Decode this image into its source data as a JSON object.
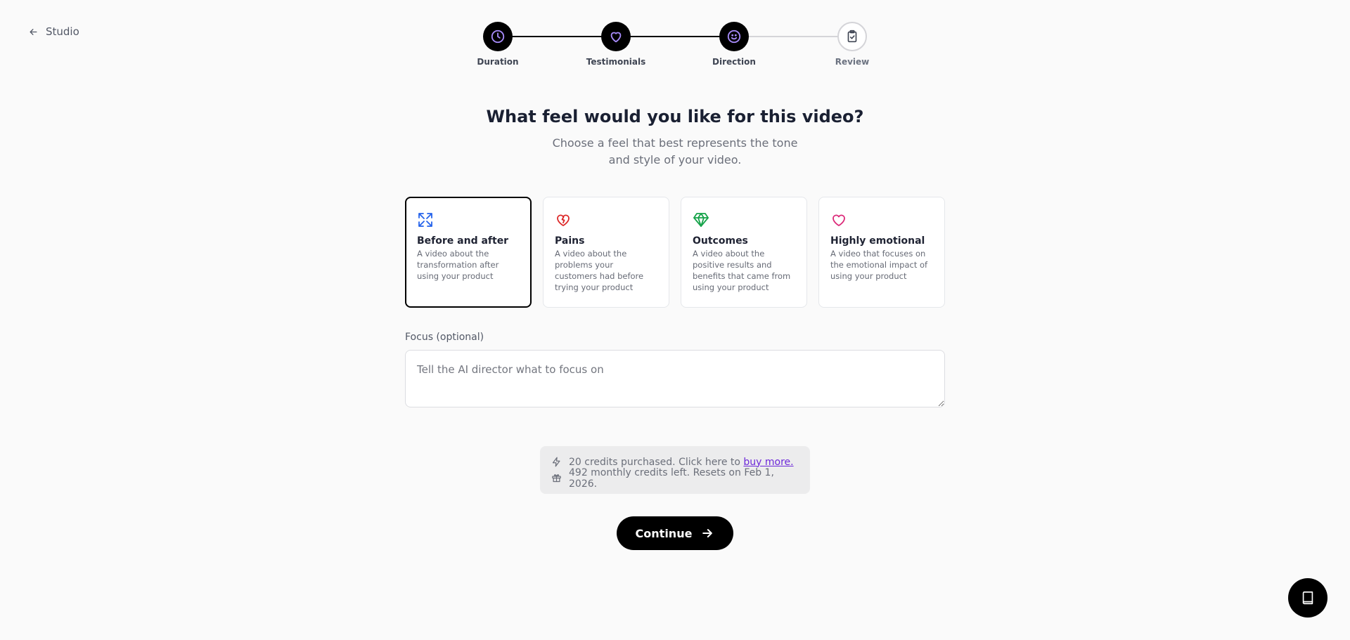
{
  "nav": {
    "back_label": "Studio",
    "back_icon": "arrow-left-icon"
  },
  "stepper": {
    "accent": "#a78bfa",
    "steps": [
      {
        "label": "Duration",
        "icon": "clock-icon",
        "status": "complete"
      },
      {
        "label": "Testimonials",
        "icon": "heart-icon",
        "status": "complete"
      },
      {
        "label": "Direction",
        "icon": "smile-icon",
        "status": "current"
      },
      {
        "label": "Review",
        "icon": "clipboard-check-icon",
        "status": "upcoming"
      }
    ]
  },
  "page": {
    "title": "What feel would you like for this video?",
    "subtitle": "Choose a feel that best represents the tone and style of your video."
  },
  "feels": [
    {
      "title": "Before and after",
      "desc": "A video about the transformation after using your product",
      "icon": "expand-arrows-icon",
      "color": "#2563eb",
      "selected": true
    },
    {
      "title": "Pains",
      "desc": "A video about the problems your customers had before trying your product",
      "icon": "broken-heart-icon",
      "color": "#dc2626",
      "selected": false
    },
    {
      "title": "Outcomes",
      "desc": "A video about the positive results and benefits that came from using your product",
      "icon": "gem-icon",
      "color": "#16a34a",
      "selected": false
    },
    {
      "title": "Highly emotional",
      "desc": "A video that focuses on the emotional impact of using your product",
      "icon": "heart-icon",
      "color": "#db2777",
      "selected": false
    }
  ],
  "focus": {
    "label": "Focus (optional)",
    "placeholder": "Tell the AI director what to focus on",
    "value": ""
  },
  "credits": {
    "purchased_text": "20 credits purchased. Click here to",
    "buy_link": "buy more.",
    "monthly_text": "492 monthly credits left. Resets on Feb 1, 2026."
  },
  "actions": {
    "continue_label": "Continue"
  },
  "help": {
    "icon": "book-icon"
  }
}
